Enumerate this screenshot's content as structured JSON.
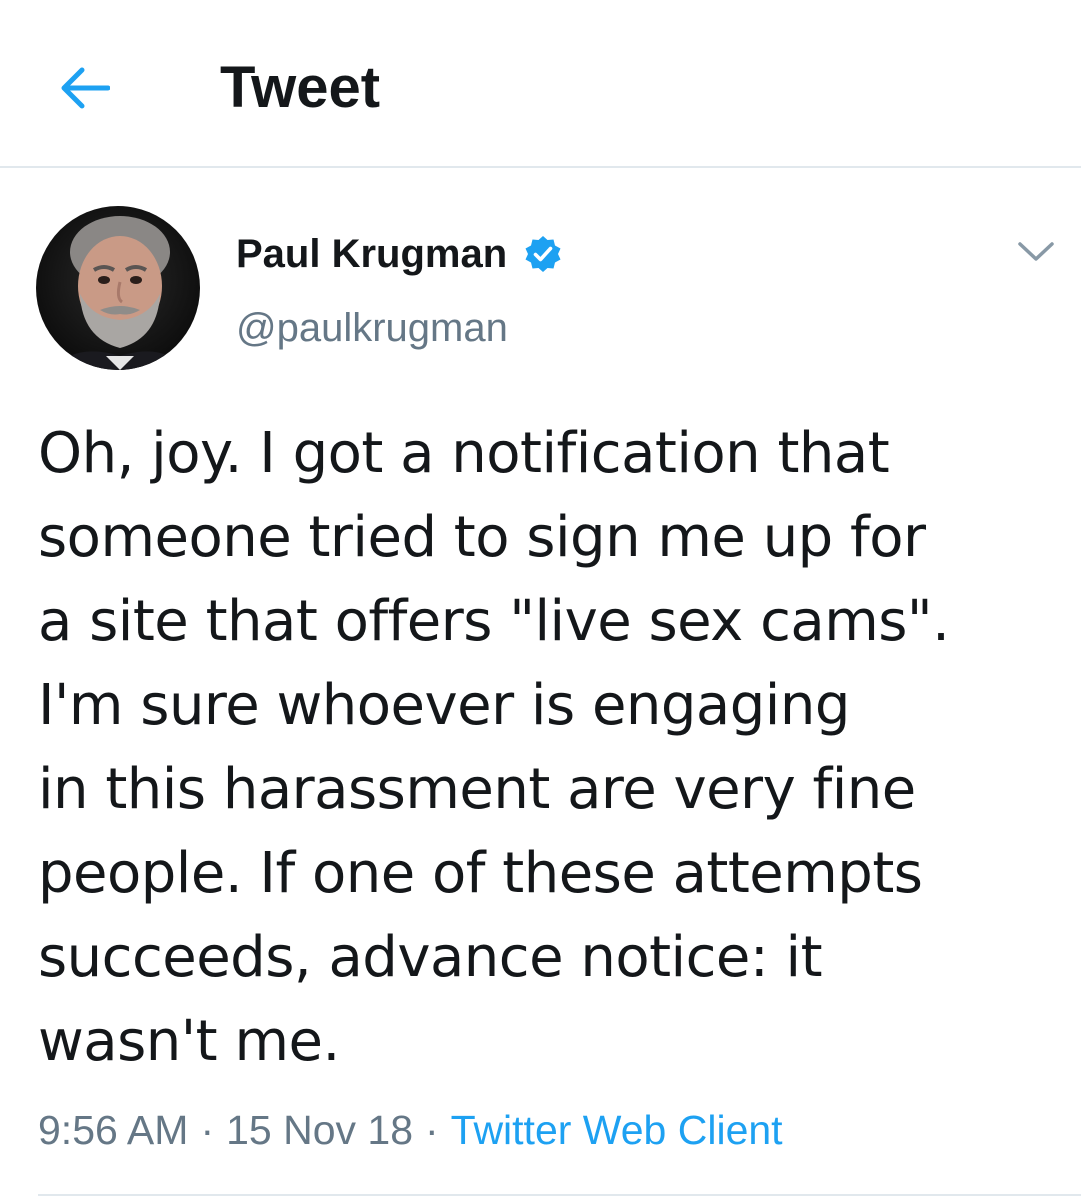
{
  "header": {
    "title": "Tweet",
    "back_icon": "arrow-left-icon"
  },
  "author": {
    "display_name": "Paul Krugman",
    "handle": "@paulkrugman",
    "verified": true,
    "verified_icon": "verified-badge-icon"
  },
  "tweet": {
    "text": "Oh, joy. I got a notification that\nsomeone tried to sign me up for\na site that offers \"live sex cams\".\nI'm sure whoever is engaging\nin this harassment are very fine\npeople. If one of these attempts\nsucceeds, advance notice: it\nwasn't me.",
    "time": "9:56 AM",
    "separator": "·",
    "date": "15 Nov 18",
    "source": "Twitter Web Client"
  },
  "icons": {
    "caret": "chevron-down-icon"
  },
  "colors": {
    "accent": "#1da1f2",
    "text": "#14171a",
    "secondary_text": "#657786",
    "divider": "#e1e8ed"
  }
}
